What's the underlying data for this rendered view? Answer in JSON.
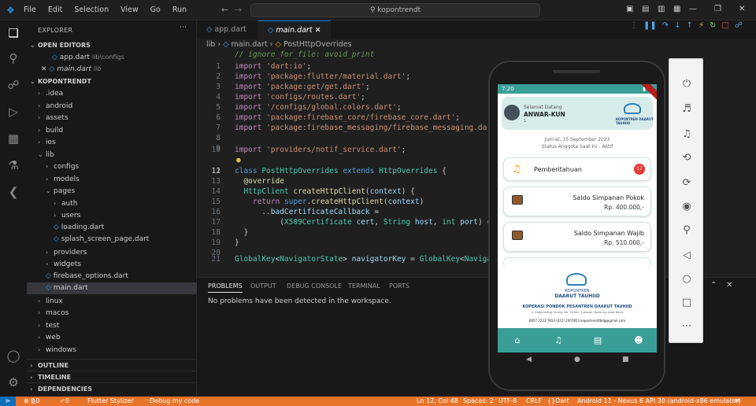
{
  "menu": [
    "File",
    "Edit",
    "Selection",
    "View",
    "Go",
    "Run"
  ],
  "search": "kopontrendt",
  "explorer": {
    "title": "EXPLORER",
    "open_editors": "OPEN EDITORS",
    "project": "KOPONTRENDT",
    "open_files": [
      {
        "name": "app.dart",
        "path": "lib\\configs"
      },
      {
        "name": "main.dart",
        "path": "lib"
      }
    ],
    "tree": [
      ".idea",
      "android",
      "assets",
      "build",
      "ios",
      "lib",
      "configs",
      "models",
      "pages",
      "auth",
      "users",
      "loading.dart",
      "splash_screen_page.dart",
      "providers",
      "widgets",
      "firebase_options.dart",
      "main.dart",
      "linux",
      "macos",
      "test",
      "web",
      "windows"
    ],
    "outline": "OUTLINE",
    "timeline": "TIMELINE",
    "dependencies": "DEPENDENCIES"
  },
  "tabs": [
    "app.dart",
    "main.dart"
  ],
  "breadcrumb": [
    "lib",
    "main.dart",
    "PostHttpOverrides"
  ],
  "panel": {
    "tabs": [
      "PROBLEMS",
      "OUTPUT",
      "DEBUG CONSOLE",
      "TERMINAL",
      "PORTS"
    ],
    "message": "No problems have been detected in the workspace."
  },
  "status": {
    "errors": "0",
    "warnings": "0",
    "ports": "0",
    "stylizer": "Flutter Stylizer",
    "debug": "Debug my code",
    "pos": "Ln 12, Col 48",
    "spaces": "Spaces: 2",
    "enc": "UTF-8",
    "eol": "CRLF",
    "lang": "Dart",
    "device": "Android 11 - Nexus 6 API 30 (android-x86 emulator)"
  },
  "app": {
    "time": "7:20",
    "greet": "Selamat Datang",
    "user": "ANWAR-KUN",
    "user_sub": "1",
    "logo_text": "KOPONTREN DAARUT TAUHIID",
    "date": "Jum'at, 15 September 2023",
    "status": "Status Anggota Saat Ini : Aktif",
    "notif_label": "Pemberitahuan",
    "notif_count": "17",
    "saldo1_label": "Saldo Simpanan Pokok",
    "saldo1_value": "Rp. 400.000,-",
    "saldo2_label": "Saldo Simpanan Wajib",
    "saldo2_value": "Rp. 510.000,-",
    "footer_brand": "KOPONTREN",
    "footer_brand2": "DAARUT TAUHIID",
    "footer_title": "KOPERASI PONDOK PESANTREN DAARUT TAUHIID",
    "footer_addr": "Jl. Gegerkalong Girang, No. 38 Kec. Sukasari, Bandung, Jawa Barat",
    "footer_contact": "0857 2223 7810   (022) 2007853   kopontrendtbdg@gmail.com"
  },
  "colors": {
    "accent": "#3a9e97",
    "status": "#e8742a"
  }
}
